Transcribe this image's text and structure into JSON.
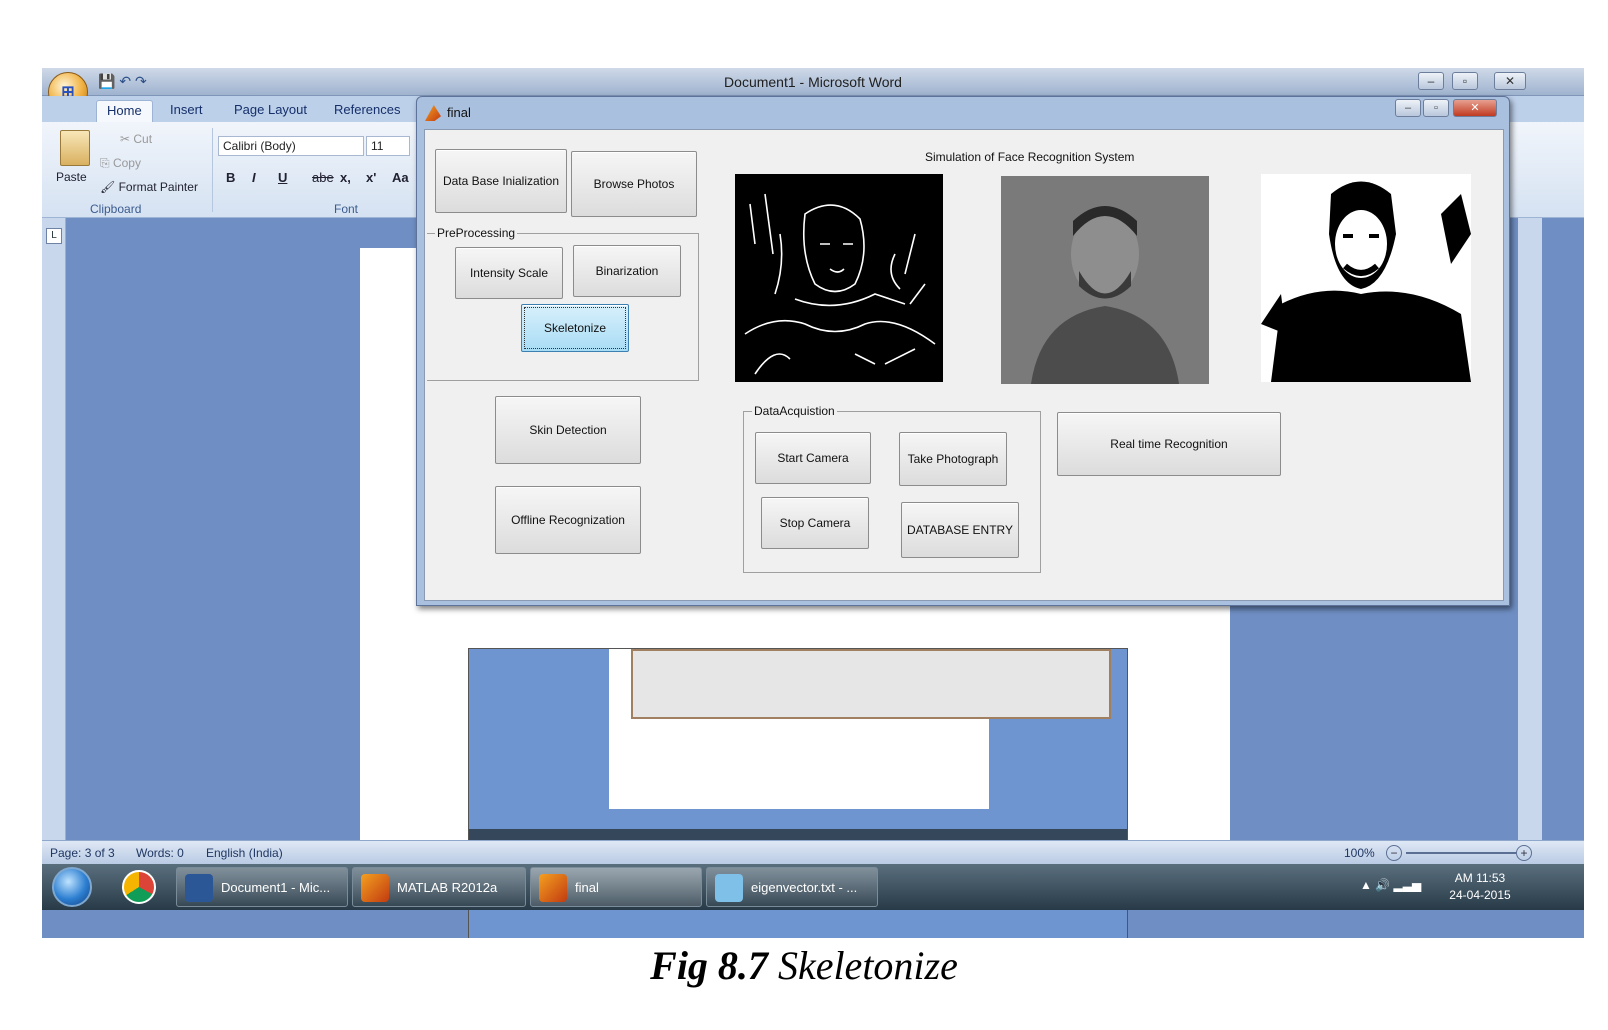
{
  "word": {
    "window_title": "Document1 - Microsoft Word",
    "tabs": [
      "Home",
      "Insert",
      "Page Layout",
      "References"
    ],
    "clipboard": {
      "paste": "Paste",
      "cut": "Cut",
      "copy": "Copy",
      "format_painter": "Format Painter",
      "group_label": "Clipboard"
    },
    "font": {
      "family": "Calibri (Body)",
      "size": "11",
      "group_label": "Font",
      "buttons": [
        "B",
        "I",
        "U",
        "abe",
        "x,",
        "x'",
        "Aa"
      ]
    },
    "ruler_corner": "L",
    "status": {
      "page": "Page: 3 of 3",
      "words": "Words: 0",
      "language": "English (India)",
      "zoom": "100%"
    }
  },
  "taskbar": {
    "items": [
      {
        "label": "Document1 - Mic...",
        "icon": "word-icon"
      },
      {
        "label": "MATLAB R2012a",
        "icon": "matlab-icon"
      },
      {
        "label": "final",
        "icon": "matlab-icon"
      },
      {
        "label": "eigenvector.txt - ...",
        "icon": "notepad-icon"
      }
    ],
    "time": "AM 11:53",
    "date": "24-04-2015"
  },
  "figure": {
    "title": "final",
    "sim_title": "Simulation of Face Recognition System",
    "buttons": {
      "db_init": "Data Base Inialization",
      "browse": "Browse Photos",
      "intensity": "Intensity Scale",
      "binarization": "Binarization",
      "skeletonize": "Skeletonize",
      "skin": "Skin Detection",
      "offline": "Offline Recognization",
      "start_camera": "Start Camera",
      "take_photo": "Take Photograph",
      "stop_camera": "Stop Camera",
      "db_entry": "DATABASE ENTRY",
      "realtime": "Real time Recognition"
    },
    "panels": {
      "preprocessing": "PreProcessing",
      "data_acq": "DataAcquistion"
    },
    "images": [
      "skeleton-edge-image",
      "grayscale-face-photo",
      "binarized-face-image"
    ]
  },
  "caption": {
    "fig_number": "Fig 8.7",
    "fig_text": "Skeletonize"
  }
}
